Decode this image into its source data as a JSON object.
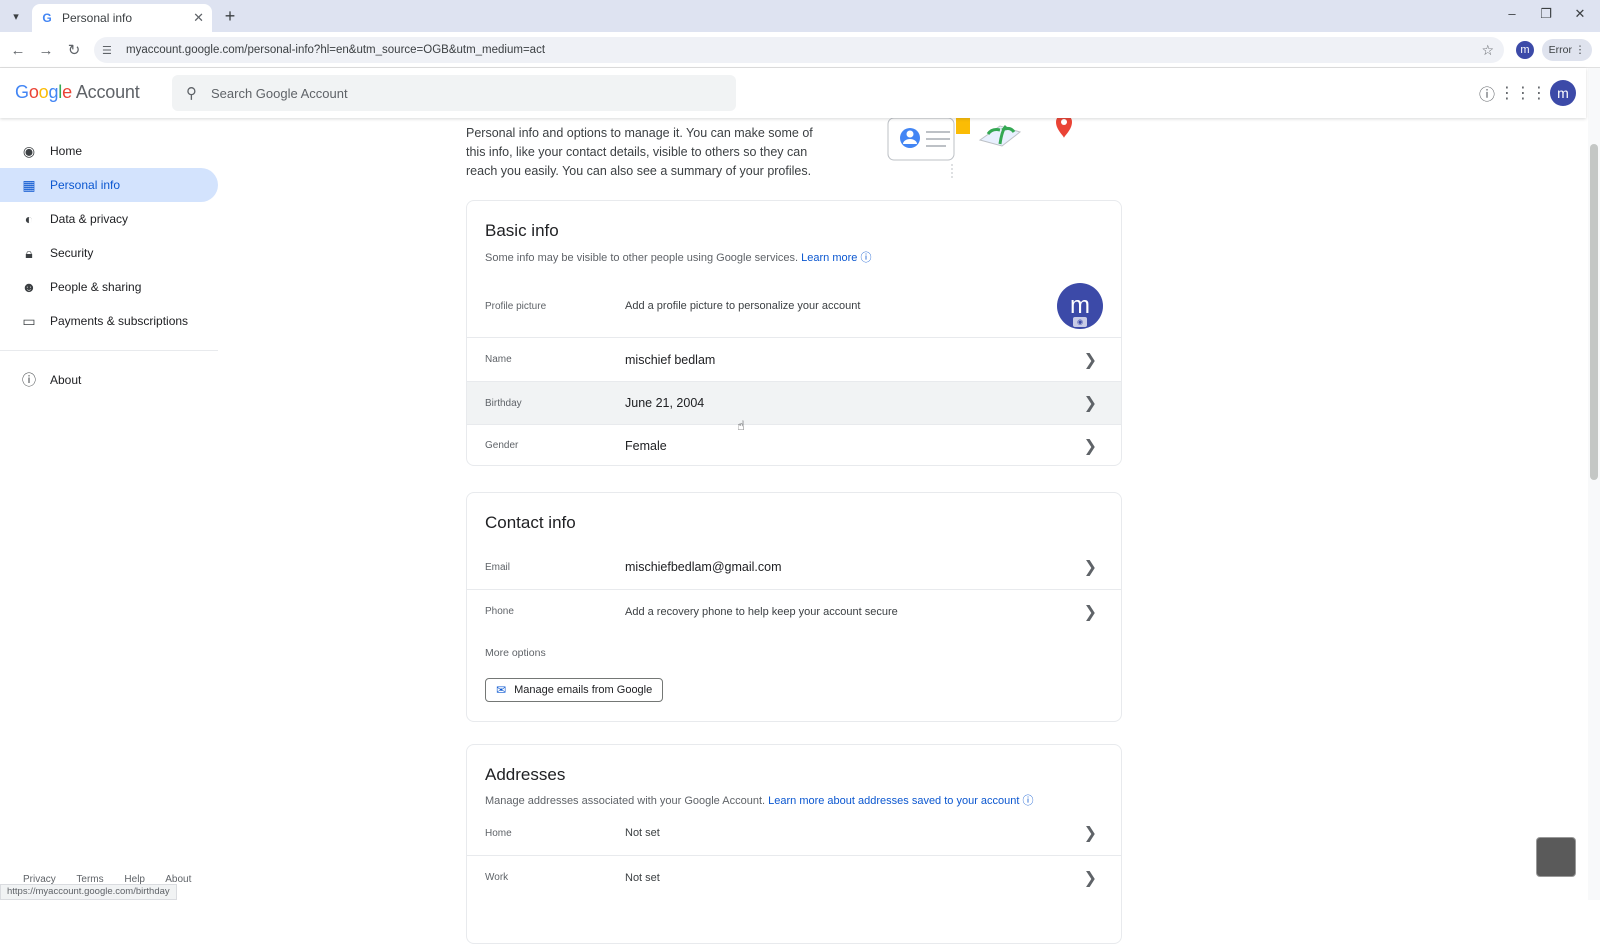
{
  "browser": {
    "tab_title": "Personal info",
    "url": "myaccount.google.com/personal-info?hl=en&utm_source=OGB&utm_medium=act",
    "profile_initial": "m",
    "error_label": "Error",
    "status_url": "https://myaccount.google.com/birthday"
  },
  "header": {
    "logo_letters": [
      "G",
      "o",
      "o",
      "g",
      "l",
      "e"
    ],
    "logo_suffix": "Account",
    "search_placeholder": "Search Google Account",
    "avatar_initial": "m"
  },
  "sidebar": {
    "items": [
      {
        "label": "Home",
        "icon": "home-icon"
      },
      {
        "label": "Personal info",
        "icon": "id-card-icon"
      },
      {
        "label": "Data & privacy",
        "icon": "toggle-icon"
      },
      {
        "label": "Security",
        "icon": "lock-icon"
      },
      {
        "label": "People & sharing",
        "icon": "people-icon"
      },
      {
        "label": "Payments & subscriptions",
        "icon": "credit-card-icon"
      }
    ],
    "about": {
      "label": "About",
      "icon": "info-icon"
    },
    "footer": [
      "Privacy",
      "Terms",
      "Help",
      "About"
    ]
  },
  "main": {
    "intro": "Personal info and options to manage it. You can make some of this info, like your contact details, visible to others so they can reach you easily. You can also see a summary of your profiles.",
    "basic_info": {
      "title": "Basic info",
      "subtitle": "Some info may be visible to other people using Google services.",
      "learn_more": "Learn more",
      "profile_picture": {
        "label": "Profile picture",
        "value": "Add a profile picture to personalize your account",
        "initial": "m"
      },
      "name": {
        "label": "Name",
        "value": "mischief bedlam"
      },
      "birthday": {
        "label": "Birthday",
        "value": "June 21, 2004"
      },
      "gender": {
        "label": "Gender",
        "value": "Female"
      }
    },
    "contact_info": {
      "title": "Contact info",
      "email": {
        "label": "Email",
        "value": "mischiefbedlam@gmail.com"
      },
      "phone": {
        "label": "Phone",
        "value": "Add a recovery phone to help keep your account secure"
      },
      "more_options": "More options",
      "manage_button": "Manage emails from Google"
    },
    "addresses": {
      "title": "Addresses",
      "subtitle": "Manage addresses associated with your Google Account.",
      "learn_more": "Learn more about addresses saved to your account",
      "home": {
        "label": "Home",
        "value": "Not set"
      },
      "work": {
        "label": "Work",
        "value": "Not set"
      }
    }
  },
  "colors": {
    "accent": "#0b57d0",
    "active_nav_bg": "#d3e3fd",
    "avatar_bg": "#3c4aa8"
  }
}
